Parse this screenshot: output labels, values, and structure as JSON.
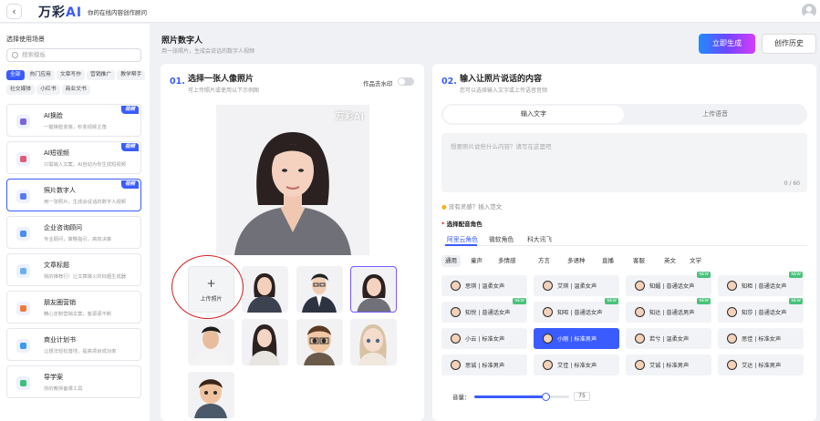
{
  "topbar": {
    "back_icon": "chevron-left-icon",
    "logo_text": "万彩",
    "logo_mark": "AI",
    "tagline": "你的在线内容创作顾问",
    "avatar_icon": "user-avatar-icon"
  },
  "sidebar": {
    "title": "选择使用场景",
    "search_placeholder": "搜索模板",
    "chips": [
      "全部",
      "热门应用",
      "文章写作",
      "营销推广",
      "教学帮手",
      "社交媒体",
      "小红书",
      "商业文书"
    ],
    "active_chip": "全部",
    "scenes": [
      {
        "title": "AI换脸",
        "desc": "一键换脸变装，秒变视频主角",
        "badge": "视频",
        "icon": "face-swap-icon",
        "color": "#7a64e0"
      },
      {
        "title": "AI短视频",
        "desc": "只需输入文案，AI自动为你生成短视频",
        "badge": "视频",
        "icon": "short-video-icon",
        "color": "#e05a74"
      },
      {
        "title": "照片数字人",
        "desc": "用一张照片，生成会说话的数字人视频",
        "badge": "视频",
        "icon": "digital-human-icon",
        "color": "#5a7af0"
      },
      {
        "title": "企业咨询顾问",
        "desc": "专业顾问，策略指引，高效决策",
        "badge": "",
        "icon": "consult-icon",
        "color": "#4a8ef0"
      },
      {
        "title": "文章标题",
        "desc": "我的推荐行！让文章爆火的标题生成器",
        "badge": "",
        "icon": "title-icon",
        "color": "#6ab0f0"
      },
      {
        "title": "朋友圈营销",
        "desc": "精心定制营销文案，客源源不断",
        "badge": "",
        "icon": "moments-icon",
        "color": "#f07a3a"
      },
      {
        "title": "商业计划书",
        "desc": "让想法轻松落地，提高项目成功率",
        "badge": "",
        "icon": "business-plan-icon",
        "color": "#3a9af0"
      },
      {
        "title": "导学案",
        "desc": "你的教师备课工具",
        "badge": "",
        "icon": "study-guide-icon",
        "color": "#3ac07a"
      }
    ]
  },
  "main": {
    "title": "照片数字人",
    "subtitle": "用一张照片，生成会说话的数字人视频",
    "generate_label": "立即生成",
    "history_label": "创作历史"
  },
  "left_panel": {
    "num": "01.",
    "heading": "选择一张人像照片",
    "sub": "可上传照片或使用以下示例图",
    "watermark_label": "作品去水印",
    "watermark_on": false,
    "photo_watermark": "万彩AI",
    "upload_label": "上传照片",
    "upload_plus": "+",
    "presets": [
      "businesswoman",
      "businessman",
      "woman-smile",
      "man-young",
      "woman-longhair",
      "cartoon-boy",
      "cartoon-girl",
      "cartoon-man"
    ],
    "selected_preset": 2
  },
  "right_panel": {
    "num": "02.",
    "heading": "输入让照片说话的内容",
    "sub": "您可以选择输入文字或上传语音音频",
    "tabs": [
      "输入文字",
      "上传语音"
    ],
    "active_tab": "输入文字",
    "text_placeholder": "想要照片说些什么内容？请写在这里吧",
    "char_count": "0 / 60",
    "hint_icon": "bulb-icon",
    "hint": "没有灵感？插入范文",
    "voice_label_star": "*",
    "voice_label": "选择配音角色",
    "providers": [
      "阿里云角色",
      "微软角色",
      "科大讯飞"
    ],
    "active_provider": "阿里云角色",
    "categories": [
      "通用",
      "童声",
      "多情感",
      "方言",
      "多语种",
      "直播",
      "客服",
      "英文",
      "文学"
    ],
    "active_category": "通用",
    "voices": [
      {
        "name": "思琪 | 温柔女声",
        "new": false
      },
      {
        "name": "艾琪 | 温柔女声",
        "new": false
      },
      {
        "name": "知媚 | 普通话女声",
        "new": true
      },
      {
        "name": "知柜 | 普通话女声",
        "new": true
      },
      {
        "name": "知悦 | 普通话女声",
        "new": true
      },
      {
        "name": "知昭 | 普通话女声",
        "new": true
      },
      {
        "name": "知达 | 普通话男声",
        "new": true
      },
      {
        "name": "知莎 | 普通话女声",
        "new": true
      },
      {
        "name": "小云 | 标准女声",
        "new": false
      },
      {
        "name": "小刚 | 标准男声",
        "new": false
      },
      {
        "name": "若兮 | 温柔女声",
        "new": false
      },
      {
        "name": "思佳 | 标准女声",
        "new": false
      },
      {
        "name": "思诚 | 标准男声",
        "new": false
      },
      {
        "name": "艾佳 | 标准女声",
        "new": false
      },
      {
        "name": "艾诚 | 标准男声",
        "new": false
      },
      {
        "name": "艾达 | 标准男声",
        "new": false
      }
    ],
    "selected_voice": 9,
    "new_badge": "NEW",
    "volume_label": "音量：",
    "volume_value": "75",
    "volume": 75
  },
  "colors": {
    "accent": "#3a5cff",
    "annotation": "#d42020",
    "new_badge": "#48c178"
  }
}
